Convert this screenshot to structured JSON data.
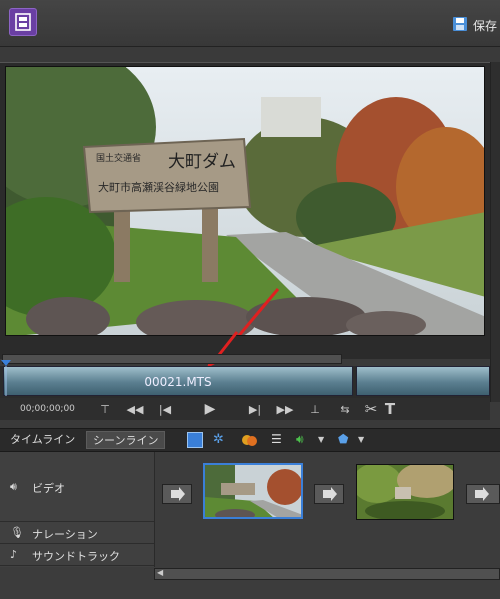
{
  "toolbar": {
    "save_label": "保存"
  },
  "preview": {
    "sign_line1": "国土交通省",
    "sign_title": "大町ダム",
    "sign_line2": "大町市高瀬渓谷緑地公園"
  },
  "clip": {
    "name": "00021.MTS"
  },
  "transport": {
    "timecode": "00;00;00;00"
  },
  "tabs": {
    "timeline": "タイムライン",
    "sceneline": "シーンライン"
  },
  "tracks": {
    "video": "ビデオ",
    "narration": "ナレーション",
    "soundtrack": "サウンドトラック"
  },
  "colors": {
    "accent_purple": "#6a3fa3",
    "annotation_arrow": "#e02020",
    "selection_blue": "#3a7fd8"
  }
}
